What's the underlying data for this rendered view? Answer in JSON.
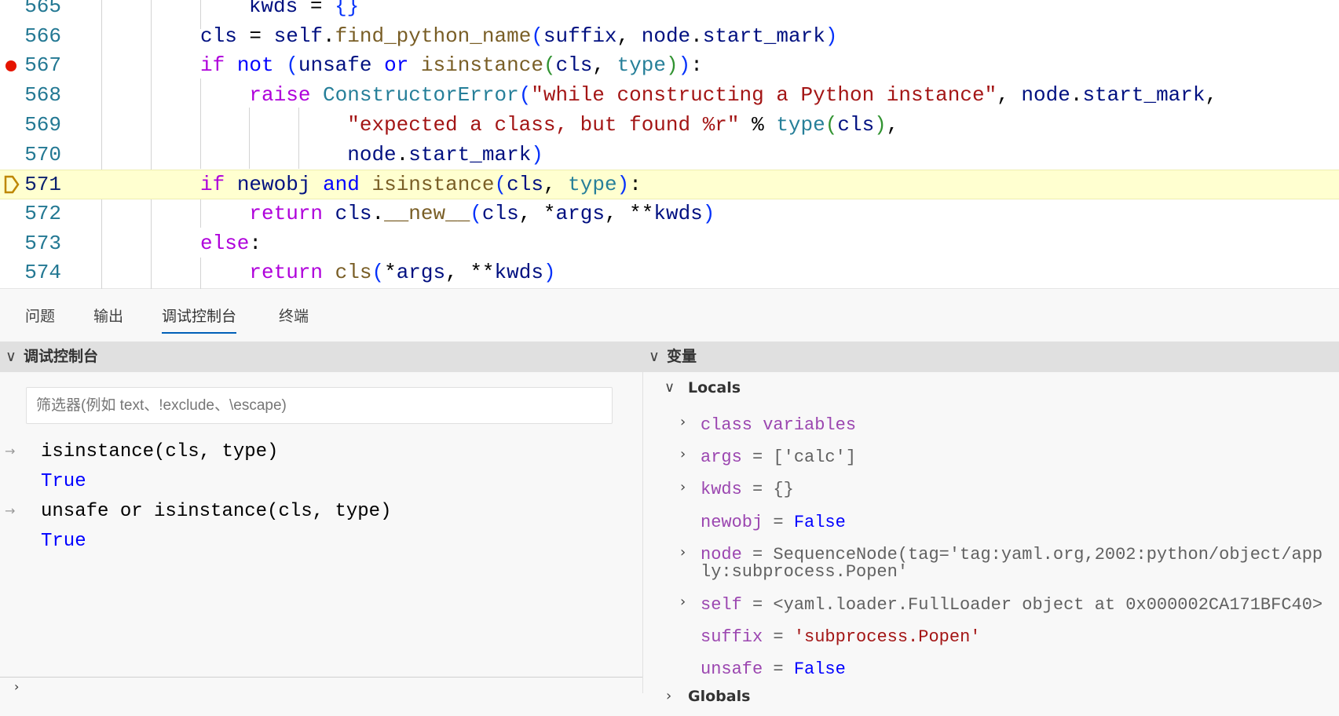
{
  "editor": {
    "current_line": "571",
    "breakpoint_line": "567",
    "lines": [
      {
        "n": "565",
        "t": [
          [
            "        ",
            "pl"
          ],
          [
            "kwds",
            "va"
          ],
          [
            " = ",
            "pl"
          ],
          [
            "{}",
            "br"
          ]
        ]
      },
      {
        "n": "566",
        "t": [
          [
            "cls",
            "va"
          ],
          [
            " = ",
            "pl"
          ],
          [
            "self",
            "va"
          ],
          [
            ".",
            "pl"
          ],
          [
            "find_python_name",
            "fn"
          ],
          [
            "(",
            "br"
          ],
          [
            "suffix",
            "va"
          ],
          [
            ", ",
            "pl"
          ],
          [
            "node",
            "va"
          ],
          [
            ".",
            "pl"
          ],
          [
            "start_mark",
            "va"
          ],
          [
            ")",
            "br"
          ]
        ]
      },
      {
        "n": "567",
        "t": [
          [
            "if",
            "kw"
          ],
          [
            " ",
            "pl"
          ],
          [
            "not",
            "op"
          ],
          [
            " ",
            "pl"
          ],
          [
            "(",
            "br"
          ],
          [
            "unsafe",
            "va"
          ],
          [
            " ",
            "pl"
          ],
          [
            "or",
            "op"
          ],
          [
            " ",
            "pl"
          ],
          [
            "isinstance",
            "fn"
          ],
          [
            "(",
            "br2"
          ],
          [
            "cls",
            "va"
          ],
          [
            ", ",
            "pl"
          ],
          [
            "type",
            "cl"
          ],
          [
            ")",
            "br2"
          ],
          [
            ")",
            "br"
          ],
          [
            ":",
            "pl"
          ]
        ]
      },
      {
        "n": "568",
        "t": [
          [
            "    ",
            "pl"
          ],
          [
            "raise",
            "kw"
          ],
          [
            " ",
            "pl"
          ],
          [
            "ConstructorError",
            "cl"
          ],
          [
            "(",
            "br"
          ],
          [
            "\"while constructing a Python instance\"",
            "st"
          ],
          [
            ", ",
            "pl"
          ],
          [
            "node",
            "va"
          ],
          [
            ".",
            "pl"
          ],
          [
            "start_mark",
            "va"
          ],
          [
            ",",
            "pl"
          ]
        ]
      },
      {
        "n": "569",
        "t": [
          [
            "            ",
            "pl"
          ],
          [
            "\"expected a class, but found %r\"",
            "st"
          ],
          [
            " % ",
            "pl"
          ],
          [
            "type",
            "cl"
          ],
          [
            "(",
            "br2"
          ],
          [
            "cls",
            "va"
          ],
          [
            ")",
            "br2"
          ],
          [
            ",",
            "pl"
          ]
        ]
      },
      {
        "n": "570",
        "t": [
          [
            "            ",
            "pl"
          ],
          [
            "node",
            "va"
          ],
          [
            ".",
            "pl"
          ],
          [
            "start_mark",
            "va"
          ],
          [
            ")",
            "br"
          ]
        ]
      },
      {
        "n": "571",
        "t": [
          [
            "if",
            "kw"
          ],
          [
            " ",
            "pl"
          ],
          [
            "newobj",
            "va"
          ],
          [
            " ",
            "pl"
          ],
          [
            "and",
            "op"
          ],
          [
            " ",
            "pl"
          ],
          [
            "isinstance",
            "fn"
          ],
          [
            "(",
            "br"
          ],
          [
            "cls",
            "va"
          ],
          [
            ", ",
            "pl"
          ],
          [
            "type",
            "cl"
          ],
          [
            ")",
            "br"
          ],
          [
            ":",
            "pl"
          ]
        ]
      },
      {
        "n": "572",
        "t": [
          [
            "    ",
            "pl"
          ],
          [
            "return",
            "kw"
          ],
          [
            " ",
            "pl"
          ],
          [
            "cls",
            "va"
          ],
          [
            ".",
            "pl"
          ],
          [
            "__new__",
            "fn"
          ],
          [
            "(",
            "br"
          ],
          [
            "cls",
            "va"
          ],
          [
            ", *",
            "pl"
          ],
          [
            "args",
            "va"
          ],
          [
            ", **",
            "pl"
          ],
          [
            "kwds",
            "va"
          ],
          [
            ")",
            "br"
          ]
        ]
      },
      {
        "n": "573",
        "t": [
          [
            "else",
            "kw"
          ],
          [
            ":",
            "pl"
          ]
        ]
      },
      {
        "n": "574",
        "t": [
          [
            "    ",
            "pl"
          ],
          [
            "return",
            "kw"
          ],
          [
            " ",
            "pl"
          ],
          [
            "cls",
            "fn"
          ],
          [
            "(",
            "br"
          ],
          [
            "*",
            "pl"
          ],
          [
            "args",
            "va"
          ],
          [
            ", **",
            "pl"
          ],
          [
            "kwds",
            "va"
          ],
          [
            ")",
            "br"
          ]
        ]
      }
    ]
  },
  "panel_tabs": [
    {
      "label": "问题"
    },
    {
      "label": "输出"
    },
    {
      "label": "调试控制台",
      "active": true
    },
    {
      "label": "终端"
    }
  ],
  "console": {
    "title": "调试控制台",
    "filter_placeholder": "筛选器(例如 text、!exclude、\\escape)",
    "entries": [
      {
        "input": "isinstance(cls, type)",
        "output": "True"
      },
      {
        "input": "unsafe or isinstance(cls, type)",
        "output": "True"
      }
    ]
  },
  "variables": {
    "title": "变量",
    "locals_label": "Locals",
    "globals_label": "Globals",
    "items": [
      {
        "name": "class variables",
        "value": "",
        "expandable": true,
        "kind": "none"
      },
      {
        "name": "args",
        "value": "['calc']",
        "expandable": true,
        "kind": "plain"
      },
      {
        "name": "kwds",
        "value": "{}",
        "expandable": true,
        "kind": "plain"
      },
      {
        "name": "newobj",
        "value": "False",
        "expandable": false,
        "kind": "bool"
      },
      {
        "name": "node",
        "value": "SequenceNode(tag='tag:yaml.org,2002:python/object/apply:subprocess.Popen'",
        "expandable": true,
        "kind": "plain"
      },
      {
        "name": "self",
        "value": "<yaml.loader.FullLoader object at 0x000002CA171BFC40>",
        "expandable": true,
        "kind": "plain"
      },
      {
        "name": "suffix",
        "value": "'subprocess.Popen'",
        "expandable": false,
        "kind": "string"
      },
      {
        "name": "unsafe",
        "value": "False",
        "expandable": false,
        "kind": "bool"
      }
    ]
  }
}
